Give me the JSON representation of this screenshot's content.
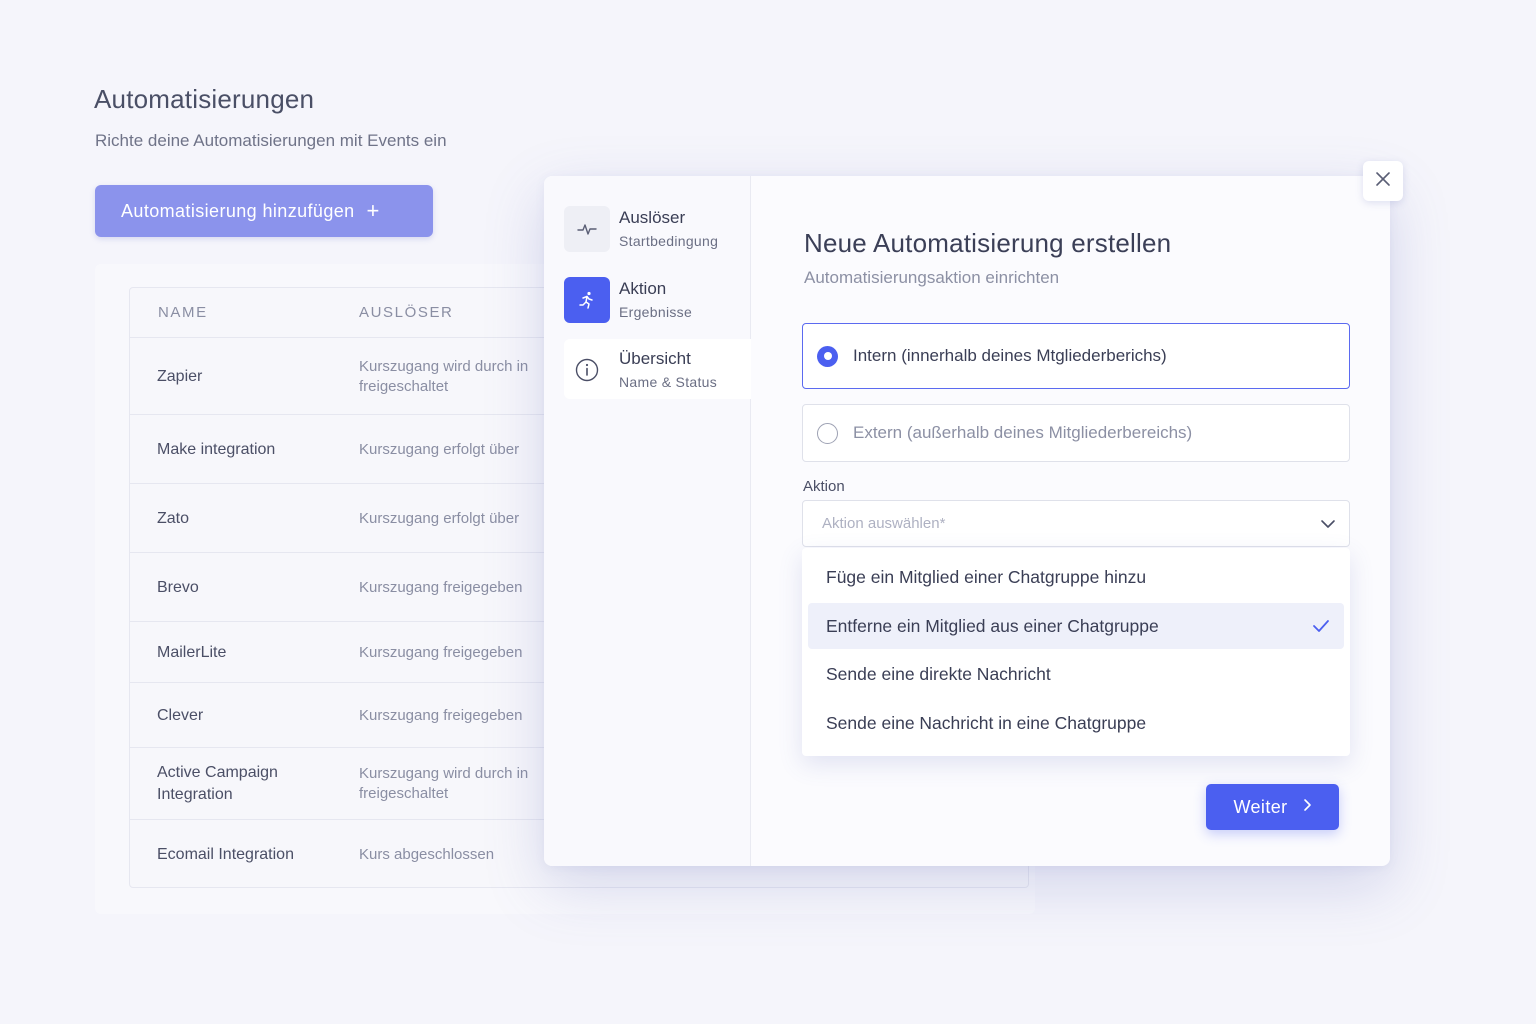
{
  "page": {
    "title": "Automatisierungen",
    "subtitle": "Richte deine Automatisierungen mit Events ein",
    "add_button": "Automatisierung hinzufügen"
  },
  "table": {
    "headers": [
      "NAME",
      "AUSLÖSER"
    ],
    "rows": [
      {
        "name": "Zapier",
        "trigger": "Kurszugang wird durch in\nfreigeschaltet"
      },
      {
        "name": "Make integration",
        "trigger": "Kurszugang erfolgt über"
      },
      {
        "name": "Zato",
        "trigger": "Kurszugang erfolgt über"
      },
      {
        "name": "Brevo",
        "trigger": "Kurszugang freigegeben"
      },
      {
        "name": "MailerLite",
        "trigger": "Kurszugang freigegeben"
      },
      {
        "name": "Clever",
        "trigger": "Kurszugang freigegeben"
      },
      {
        "name": "Active Campaign\nIntegration",
        "trigger": "Kurszugang wird durch in\nfreigeschaltet"
      },
      {
        "name": "Ecomail Integration",
        "trigger": "Kurs abgeschlossen"
      }
    ]
  },
  "modal": {
    "steps": [
      {
        "title": "Auslöser",
        "subtitle": "Startbedingung",
        "icon": "pulse-icon"
      },
      {
        "title": "Aktion",
        "subtitle": "Ergebnisse",
        "icon": "running-person-icon"
      },
      {
        "title": "Übersicht",
        "subtitle": "Name & Status",
        "icon": "info-icon"
      }
    ],
    "title": "Neue Automatisierung erstellen",
    "subtitle": "Automatisierungsaktion einrichten",
    "options": [
      {
        "label": "Intern (innerhalb deines Mtgliederberichs)",
        "selected": true
      },
      {
        "label": "Extern (außerhalb deines Mitgliederbereichs)",
        "selected": false
      }
    ],
    "action_label": "Aktion",
    "action_placeholder": "Aktion auswählen*",
    "dropdown_items": [
      {
        "label": "Füge ein Mitglied einer Chatgruppe hinzu",
        "active": false
      },
      {
        "label": "Entferne ein Mitglied aus einer Chatgruppe",
        "active": true
      },
      {
        "label": "Sende eine direkte Nachricht",
        "active": false
      },
      {
        "label": "Sende eine Nachricht in eine Chatgruppe",
        "active": false
      }
    ],
    "next_button": "Weiter"
  },
  "colors": {
    "accent": "#4b5ff0",
    "accent_soft": "#8b93ec",
    "background": "#f5f5fb"
  }
}
